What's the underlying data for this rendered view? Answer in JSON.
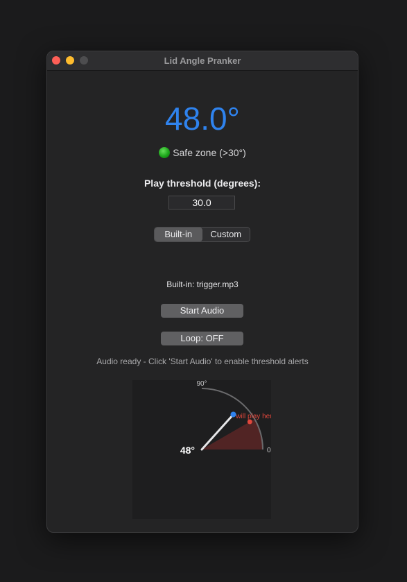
{
  "window": {
    "title": "Lid Angle Pranker"
  },
  "angle_display": "48.0°",
  "status": {
    "text": "Safe zone (>30°)",
    "color": "#1ca61a"
  },
  "threshold": {
    "label": "Play threshold (degrees):",
    "value": "30.0"
  },
  "source_mode": {
    "options": [
      "Built-in",
      "Custom"
    ],
    "selected": "Built-in"
  },
  "source_text": "Built-in: trigger.mp3",
  "buttons": {
    "start_audio": "Start Audio",
    "loop": "Loop: OFF"
  },
  "hint_text": "Audio ready - Click 'Start Audio' to enable threshold alerts",
  "gauge": {
    "angle_value": 48,
    "angle_label": "48°",
    "threshold_value": 30,
    "max_label": "90°",
    "min_label": "0°",
    "threshold_note": "will play here",
    "colors": {
      "angle": "#2f83ee",
      "threshold": "#e0473c",
      "zone_fill": "#5a2626",
      "arc": "#6a6a6c",
      "needle": "#e6e6e8"
    }
  }
}
